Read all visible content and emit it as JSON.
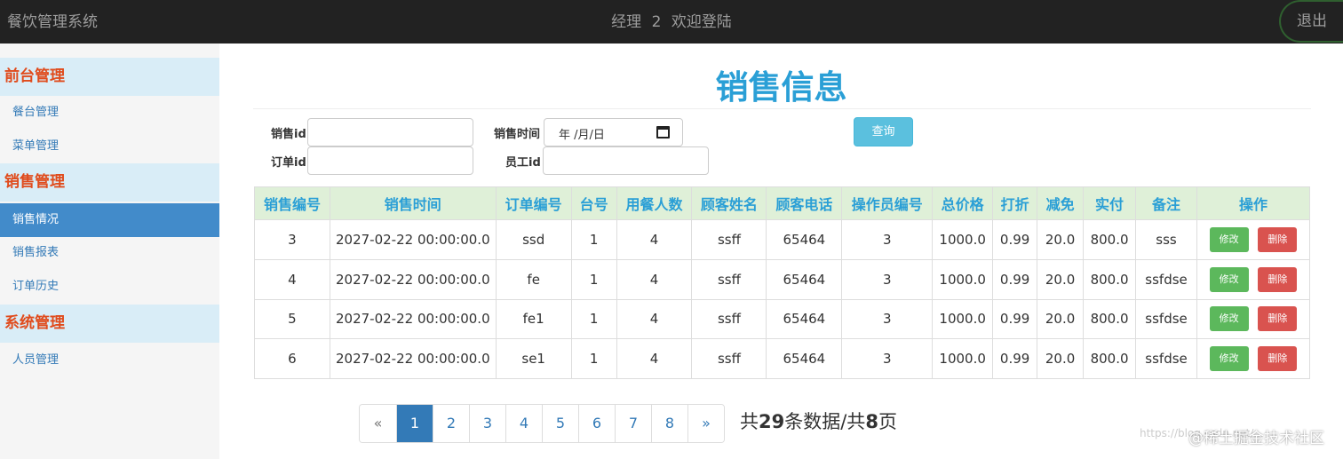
{
  "header": {
    "app_title": "餐饮管理系统",
    "role": "经理",
    "user_id": "2",
    "welcome": "欢迎登陆",
    "logout_label": "退出"
  },
  "sidebar": {
    "groups": [
      {
        "title": "前台管理",
        "items": [
          "餐台管理",
          "菜单管理"
        ]
      },
      {
        "title": "销售管理",
        "items": [
          "销售情况",
          "销售报表",
          "订单历史"
        ]
      },
      {
        "title": "系统管理",
        "items": [
          "人员管理"
        ]
      }
    ],
    "active_item": "销售情况"
  },
  "page_title": "销售信息",
  "filters": {
    "sale_id_label": "销售id",
    "sale_id_value": "",
    "order_id_label": "订单id",
    "order_id_value": "",
    "sale_time_label": "销售时间",
    "sale_time_placeholder": "年 /月/日",
    "employee_id_label": "员工id",
    "employee_id_value": "",
    "query_button": "查询"
  },
  "table": {
    "headers": [
      "销售编号",
      "销售时间",
      "订单编号",
      "台号",
      "用餐人数",
      "顾客姓名",
      "顾客电话",
      "操作员编号",
      "总价格",
      "打折",
      "减免",
      "实付",
      "备注",
      "操作"
    ],
    "rows": [
      [
        "3",
        "2027-02-22 00:00:00.0",
        "ssd",
        "1",
        "4",
        "ssff",
        "65464",
        "3",
        "1000.0",
        "0.99",
        "20.0",
        "800.0",
        "sss"
      ],
      [
        "4",
        "2027-02-22 00:00:00.0",
        "fe",
        "1",
        "4",
        "ssff",
        "65464",
        "3",
        "1000.0",
        "0.99",
        "20.0",
        "800.0",
        "ssfdse"
      ],
      [
        "5",
        "2027-02-22 00:00:00.0",
        "fe1",
        "1",
        "4",
        "ssff",
        "65464",
        "3",
        "1000.0",
        "0.99",
        "20.0",
        "800.0",
        "ssfdse"
      ],
      [
        "6",
        "2027-02-22 00:00:00.0",
        "se1",
        "1",
        "4",
        "ssff",
        "65464",
        "3",
        "1000.0",
        "0.99",
        "20.0",
        "800.0",
        "ssfdse"
      ]
    ],
    "edit_label": "修改",
    "delete_label": "删除"
  },
  "pagination": {
    "prev": "«",
    "pages": [
      "1",
      "2",
      "3",
      "4",
      "5",
      "6",
      "7",
      "8"
    ],
    "next": "»",
    "current": "1"
  },
  "summary": {
    "prefix": "共",
    "count": "29",
    "mid": "条数据/共",
    "pages": "8",
    "suffix": "页"
  },
  "watermark": {
    "url": "https://blog.csdn.net/...",
    "site": "@稀土掘金技术社区"
  }
}
